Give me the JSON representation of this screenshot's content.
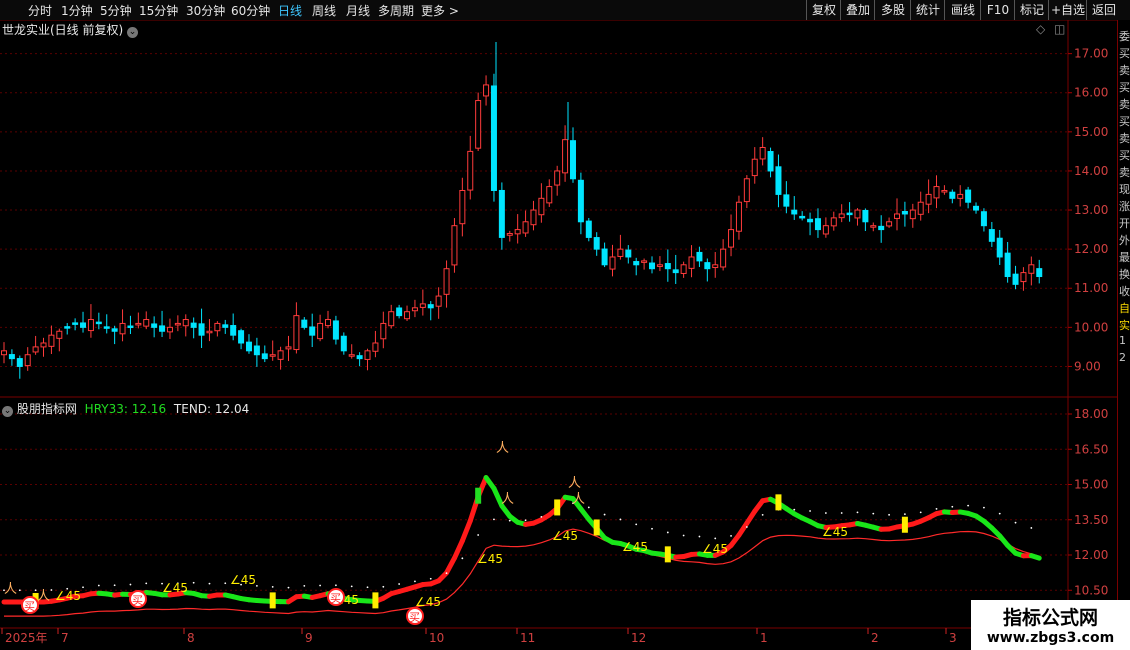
{
  "topbar": {
    "periods": [
      "分时",
      "1分钟",
      "5分钟",
      "15分钟",
      "30分钟",
      "60分钟",
      "日线",
      "周线",
      "月线",
      "多周期",
      "更多 >"
    ],
    "active_period": "日线",
    "tools": [
      "复权",
      "叠加",
      "多股",
      "统计",
      "画线",
      "F10",
      "标记",
      "+自选",
      "返回"
    ]
  },
  "main_panel": {
    "title": "世龙实业(日线 前复权)",
    "price_axis": [
      "17.00",
      "16.00",
      "15.00",
      "14.00",
      "13.00",
      "12.00",
      "11.00",
      "10.00",
      "9.00"
    ]
  },
  "indicator_panel": {
    "title": "股朋指标网",
    "hry_label": "HRY33: 12.16",
    "tend_label": "TEND: 12.04",
    "axis": [
      "18.00",
      "16.50",
      "15.00",
      "13.50",
      "12.00",
      "10.50"
    ],
    "angle_labels": [
      "∠45",
      "∠45",
      "∠45",
      "∠45",
      "∠45",
      "∠45",
      "∠45",
      "∠45",
      "∠45",
      "∠45"
    ],
    "buy_glyph": "买"
  },
  "time_axis": [
    "2025年",
    "7",
    "8",
    "9",
    "10",
    "11",
    "12",
    "1",
    "2",
    "3"
  ],
  "right_strip": [
    "委",
    "买",
    "卖",
    "买",
    "卖",
    "买",
    "卖",
    "买",
    "卖",
    "现",
    "涨",
    "开",
    "外",
    "最",
    "换",
    "收",
    "自",
    "实",
    "1",
    "2"
  ],
  "watermark": {
    "title": "指标公式网",
    "url": "www.zbgs3.com"
  },
  "colors": {
    "up": "#ff3b3b",
    "down": "#00e5ff",
    "green": "#22dd22",
    "yellow": "#ffee00",
    "grid": "#5a0000"
  },
  "chart_data": {
    "type": "candlestick",
    "symbol": "世龙实业",
    "ylim": [
      8.5,
      17.4
    ],
    "close_path": [
      9.4,
      9.2,
      9.0,
      9.3,
      9.5,
      9.6,
      9.8,
      9.9,
      10.0,
      10.1,
      10.0,
      10.2,
      10.1,
      10.0,
      9.9,
      10.1,
      10.0,
      10.1,
      10.2,
      10.0,
      9.9,
      10.0,
      10.1,
      10.2,
      10.0,
      9.8,
      9.9,
      10.1,
      10.0,
      9.8,
      9.6,
      9.4,
      9.3,
      9.2,
      9.3,
      9.4,
      9.5,
      10.3,
      10.0,
      9.8,
      10.1,
      10.2,
      9.7,
      9.4,
      9.3,
      9.2,
      9.4,
      9.6,
      10.1,
      10.4,
      10.3,
      10.4,
      10.5,
      10.6,
      10.5,
      10.8,
      11.5,
      12.6,
      13.5,
      14.5,
      15.8,
      16.2,
      13.5,
      12.3,
      12.4,
      12.5,
      12.7,
      13.0,
      13.3,
      13.6,
      14.0,
      14.8,
      13.8,
      12.7,
      12.3,
      12.0,
      11.6,
      11.8,
      12.0,
      11.8,
      11.6,
      11.7,
      11.5,
      11.6,
      11.5,
      11.4,
      11.6,
      11.8,
      11.7,
      11.5,
      11.6,
      12.0,
      12.5,
      13.2,
      13.8,
      14.3,
      14.6,
      14.0,
      13.4,
      13.1,
      12.9,
      12.8,
      12.7,
      12.5,
      12.6,
      12.8,
      12.9,
      12.9,
      13.0,
      12.7,
      12.6,
      12.5,
      12.7,
      12.9,
      12.9,
      13.0,
      13.2,
      13.4,
      13.6,
      13.5,
      13.3,
      13.4,
      13.2,
      13.0,
      12.6,
      12.2,
      11.8,
      11.3,
      11.1,
      11.4,
      11.6,
      11.3
    ]
  }
}
